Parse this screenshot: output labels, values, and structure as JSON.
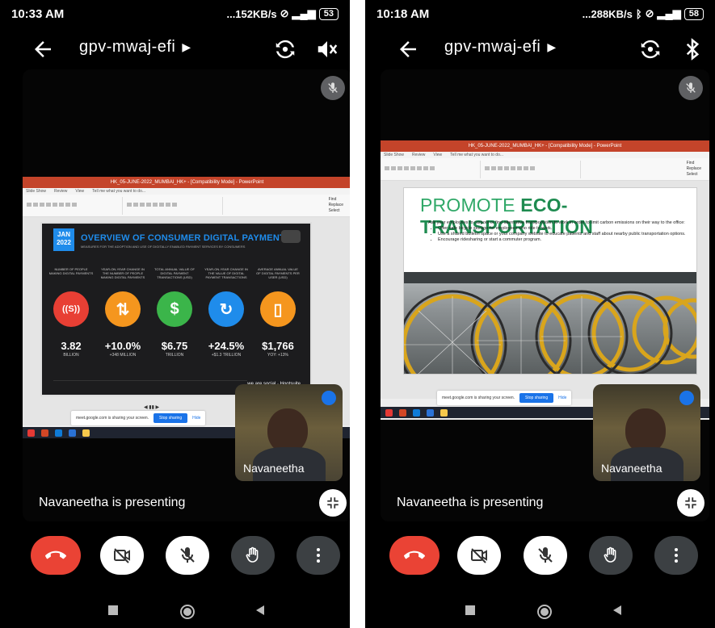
{
  "left": {
    "status": {
      "time": "10:33 AM",
      "speed": "...152KB/s",
      "battery": "53"
    },
    "meeting_code": "gpv-mwaj-efi",
    "presenter_text": "Navaneetha is presenting",
    "tile_name": "Navaneetha",
    "share": {
      "window_title": "HK_05-JUNE-2022_MUMBAI_HK+ - [Compatibility Mode] - PowerPoint",
      "tabs": [
        "Slide Show",
        "Review",
        "View",
        "Tell me what you want to do..."
      ],
      "ribbon_groups": [
        "Paragraph",
        "Drawing",
        "Editing"
      ],
      "editing": [
        "Find",
        "Replace",
        "Select"
      ],
      "slide": {
        "badge": "JAN 2022",
        "title": "OVERVIEW OF CONSUMER DIGITAL PAYMENTS",
        "subtitle": "MEASURES FOR THE ADOPTION AND USE OF DIGITALLY ENABLED PAYMENT SERVICES BY CONSUMERS",
        "columns": [
          {
            "label": "NUMBER OF PEOPLE MAKING DIGITAL PAYMENTS",
            "value": "3.82",
            "sub": "BILLION",
            "color": "#e83f34",
            "icon": "((S))"
          },
          {
            "label": "YEAR-ON-YEAR CHANGE IN THE NUMBER OF PEOPLE MAKING DIGITAL PAYMENTS",
            "value": "+10.0%",
            "sub": "+348 MILLION",
            "color": "#f5961e",
            "icon": "⇅"
          },
          {
            "label": "TOTAL ANNUAL VALUE OF DIGITAL PAYMENT TRANSACTIONS (USD)",
            "value": "$6.75",
            "sub": "TRILLION",
            "color": "#3bb54a",
            "icon": "$"
          },
          {
            "label": "YEAR-ON-YEAR CHANGE IN THE VALUE OF DIGITAL PAYMENT TRANSACTIONS",
            "value": "+24.5%",
            "sub": "+$1.3 TRILLION",
            "color": "#1f8ceb",
            "icon": "↻"
          },
          {
            "label": "AVERAGE ANNUAL VALUE OF DIGITAL PAYMENTS PER USER (USD)",
            "value": "$1,766",
            "sub": "YOY: +13%",
            "color": "#f5961e",
            "icon": "▯"
          }
        ],
        "brand": "Hootsuite",
        "brand2": "we are social"
      },
      "sharebar_text": "meet.google.com is sharing your screen.",
      "stop_label": "Stop sharing",
      "hide_label": "Hide"
    }
  },
  "right": {
    "status": {
      "time": "10:18 AM",
      "speed": "...288KB/s",
      "battery": "58"
    },
    "meeting_code": "gpv-mwaj-efi",
    "presenter_text": "Navaneetha is presenting",
    "tile_name": "Navaneetha",
    "share": {
      "window_title": "HK_05-JUNE-2022_MUMBAI_HK+ - [Compatibility Mode] - PowerPoint",
      "tabs": [
        "Slide Show",
        "Review",
        "View",
        "Tell me what you want to do..."
      ],
      "ribbon_groups": [
        "Paragraph",
        "Drawing",
        "Editing"
      ],
      "editing": [
        "Find",
        "Replace",
        "Select"
      ],
      "slide": {
        "title_thin": "PROMOTE",
        "title_bold": "ECO-TRANSPORTATION",
        "intro": "Ask your employees to carpool or find alternative transportation to work in order to limit carbon emissions on their way to the office:",
        "bullets": [
          "Offer safe bicycle storage for employees who ride to work.",
          "Use a shared bulletin space or your company website to educate patients and staff about nearby public transportation options.",
          "Encourage ridesharing or start a commuter program."
        ]
      },
      "sharebar_text": "meet.google.com is sharing your screen.",
      "stop_label": "Stop sharing",
      "hide_label": "Hide"
    }
  }
}
